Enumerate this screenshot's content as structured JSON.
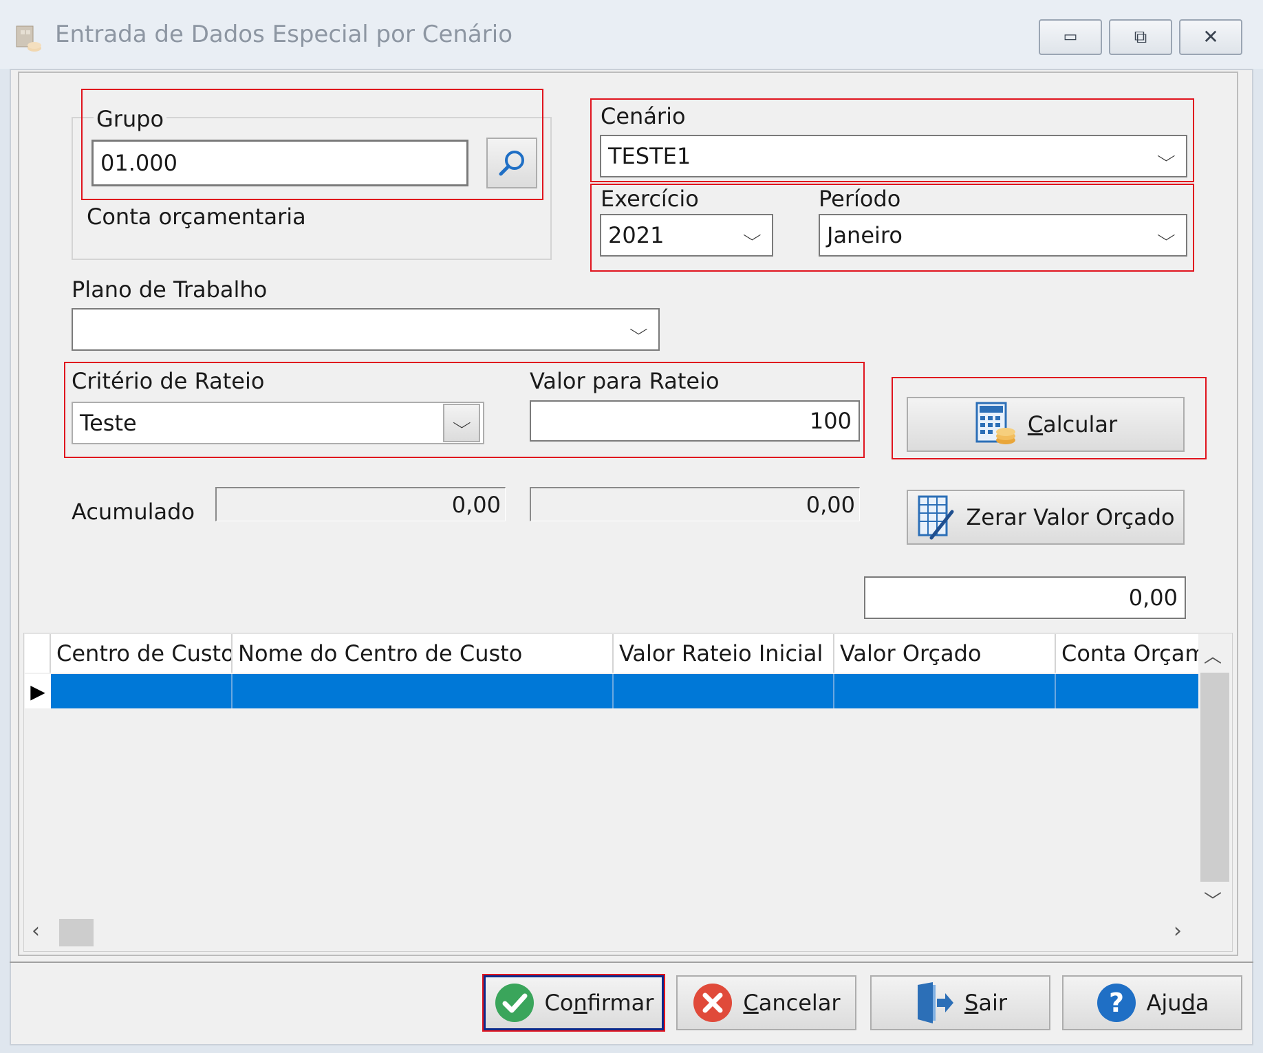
{
  "window": {
    "title": "Entrada de Dados Especial por Cenário",
    "controls": {
      "minimize": "▭",
      "restore": "⧉",
      "close": "✕"
    }
  },
  "form": {
    "grupo": {
      "label": "Grupo",
      "value": "01.000"
    },
    "conta_orcamentaria_label": "Conta orçamentaria",
    "cenario": {
      "label": "Cenário",
      "value": "TESTE1"
    },
    "exercicio": {
      "label": "Exercício",
      "value": "2021"
    },
    "periodo": {
      "label": "Período",
      "value": "Janeiro"
    },
    "plano_trabalho": {
      "label": "Plano de Trabalho",
      "value": ""
    },
    "criterio_rateio": {
      "label": "Critério de Rateio",
      "value": "Teste"
    },
    "valor_rateio": {
      "label": "Valor para Rateio",
      "value": "100"
    },
    "acumulado": {
      "label": "Acumulado",
      "value1": "0,00",
      "value2": "0,00"
    },
    "total_value": "0,00"
  },
  "buttons": {
    "calcular": {
      "accel": "C",
      "rest": "alcular"
    },
    "zerar": "Zerar Valor Orçado",
    "confirmar": {
      "pre": "Co",
      "accel": "n",
      "rest": "firmar"
    },
    "cancelar": {
      "accel": "C",
      "rest": "ancelar"
    },
    "sair": {
      "accel": "S",
      "rest": "air"
    },
    "ajuda": {
      "pre": "Aju",
      "accel": "d",
      "rest": "a"
    }
  },
  "grid": {
    "columns": [
      "Centro de Custo",
      "Nome do Centro de Custo",
      "Valor Rateio Inicial",
      "Valor Orçado",
      "Conta Orçam"
    ]
  },
  "colors": {
    "highlight_border": "#e0141e",
    "selected_row": "#0078d7",
    "confirm_icon": "#3aa55b",
    "cancel_icon": "#e04a3a",
    "help_icon": "#1f6fc5"
  }
}
